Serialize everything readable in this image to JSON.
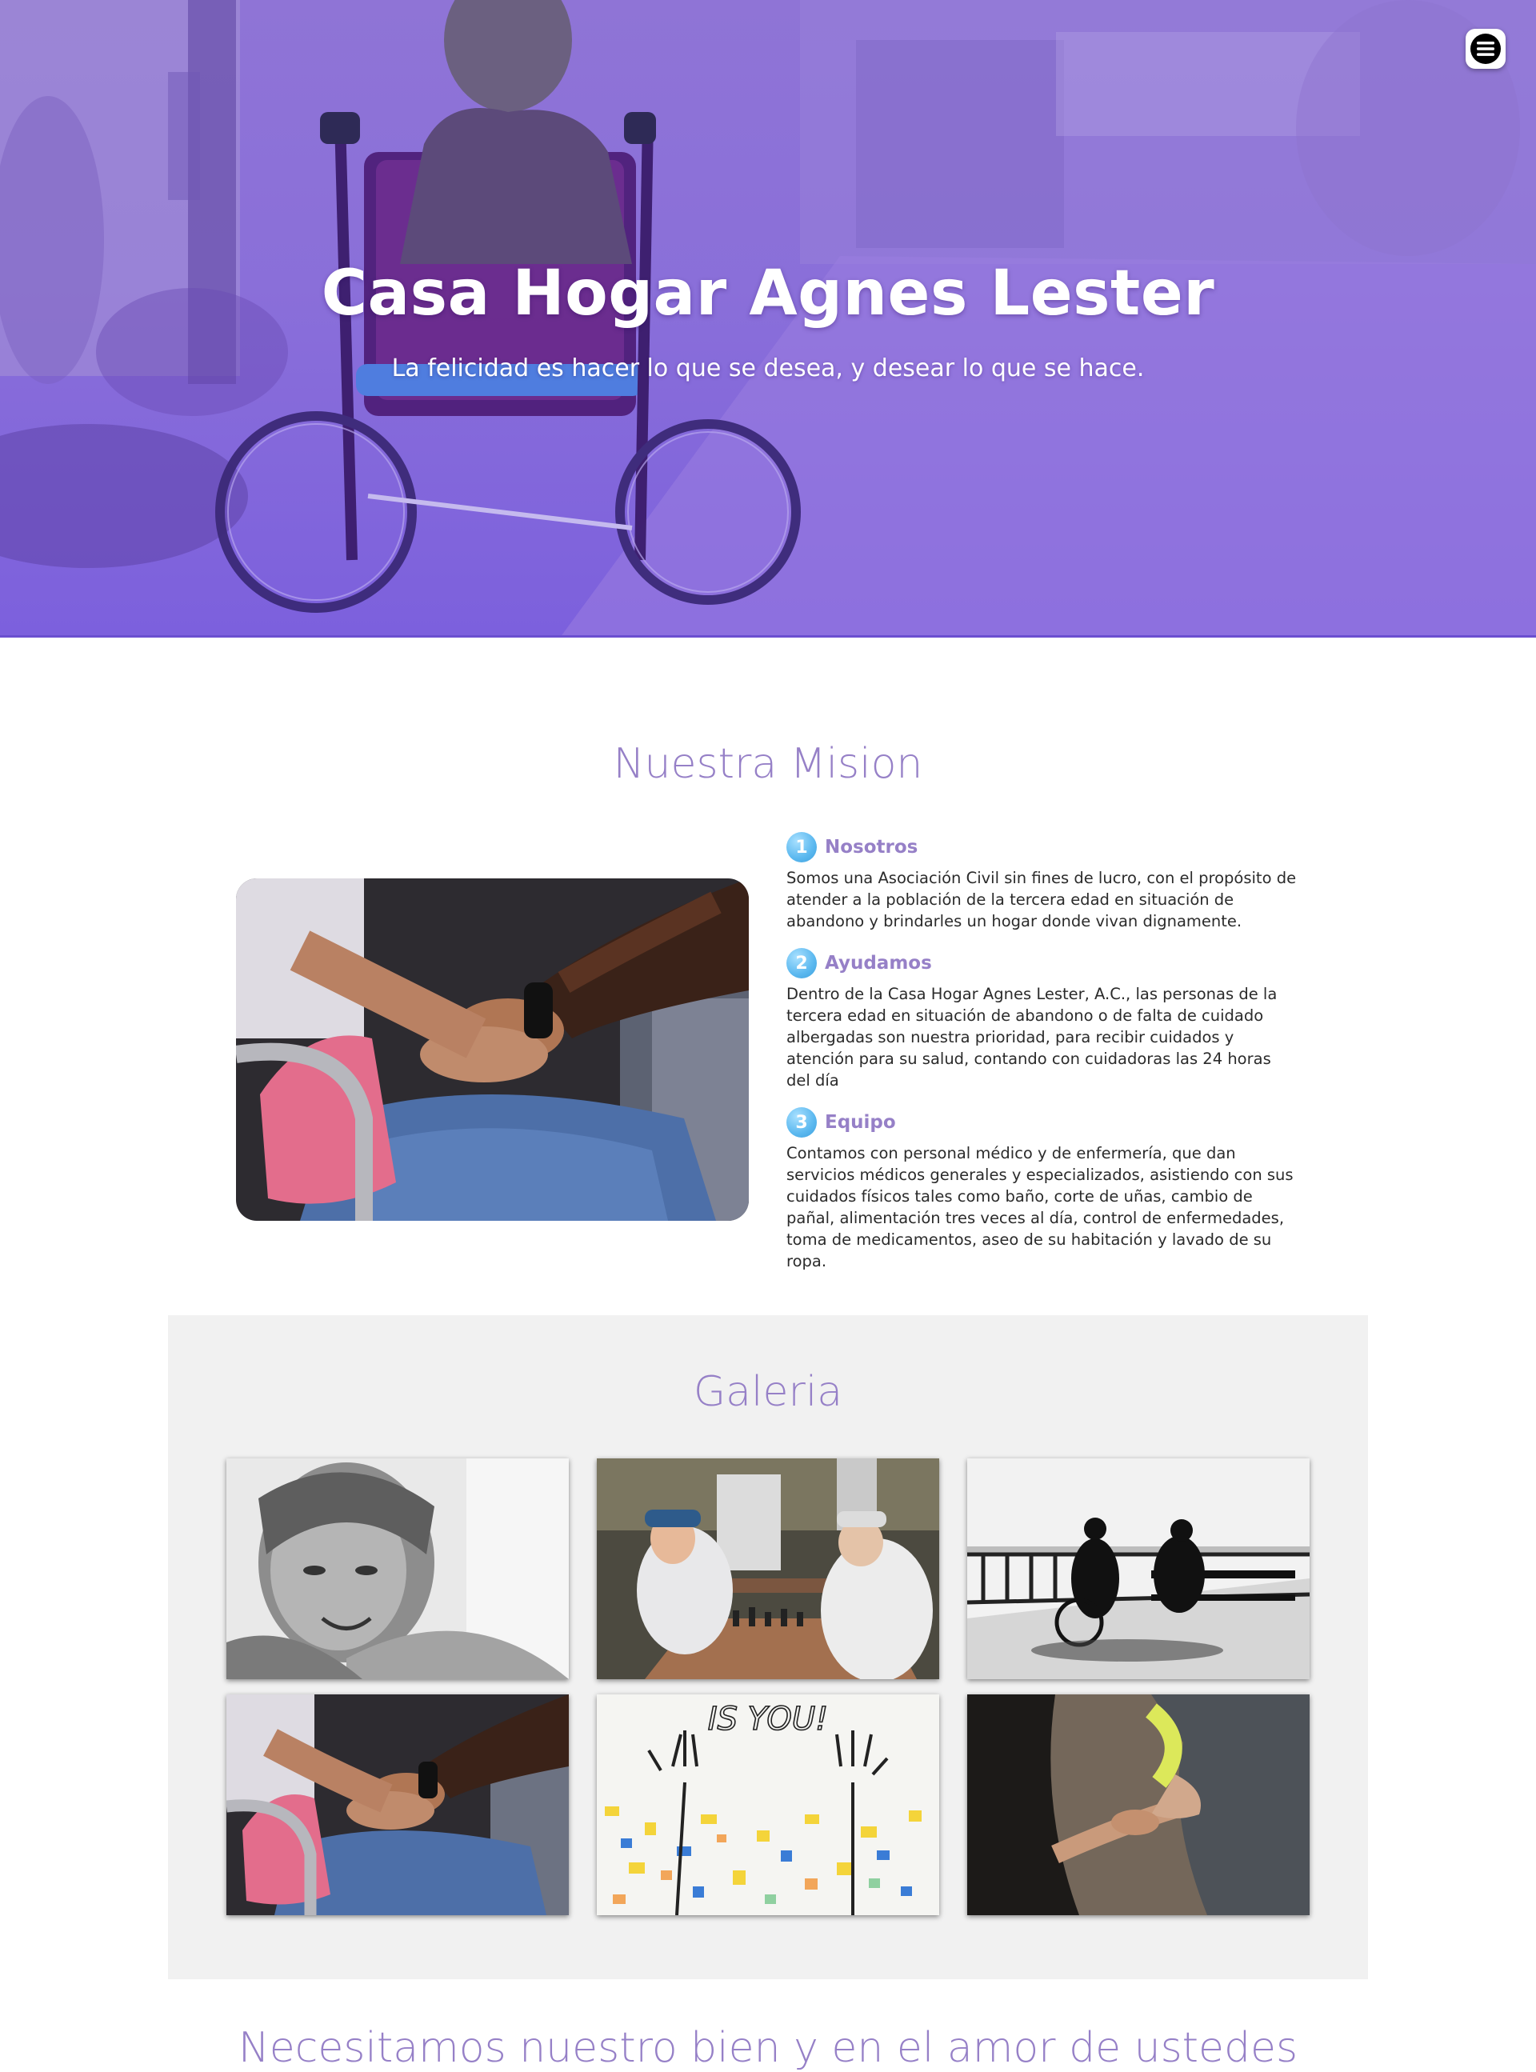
{
  "hero": {
    "title": "Casa Hogar Agnes Lester",
    "subtitle": "La felicidad es hacer lo que se desea, y desear lo que se hace.",
    "menu_icon": "hamburger-icon"
  },
  "mision": {
    "title": "Nuestra Mision",
    "items": [
      {
        "number": "1",
        "heading": "Nosotros",
        "text": "Somos una Asociación Civil sin fines de lucro, con el propósito de atender a la población de la tercera edad en situación de abandono y brindarles un hogar donde vivan dignamente."
      },
      {
        "number": "2",
        "heading": "Ayudamos",
        "text": "Dentro de la Casa Hogar Agnes Lester, A.C., las personas de la tercera edad en situación de abandono o de falta de cuidado albergadas son nuestra prioridad, para recibir cuidados y atención para su salud, contando con cuidadoras las 24 horas del día"
      },
      {
        "number": "3",
        "heading": "Equipo",
        "text": "Contamos con personal médico y de enfermería, que dan servicios médicos generales y especializados, asistiendo con sus cuidados físicos tales como baño, corte de uñas, cambio de pañal, alimentación tres veces al día, control de enfermedades, toma de medicamentos, aseo de su habitación y lavado de su ropa."
      }
    ]
  },
  "galeria": {
    "title": "Galeria",
    "mural_text": "IS YOU!"
  },
  "next_section": {
    "title": "Necesitamos nuestro bien y en el amor de ustedes"
  },
  "colors": {
    "accent": "#9680c7",
    "hero_overlay": "#8a6fd9",
    "number_badge": "#5bb8ef",
    "gallery_bg": "#f1f1f1"
  }
}
